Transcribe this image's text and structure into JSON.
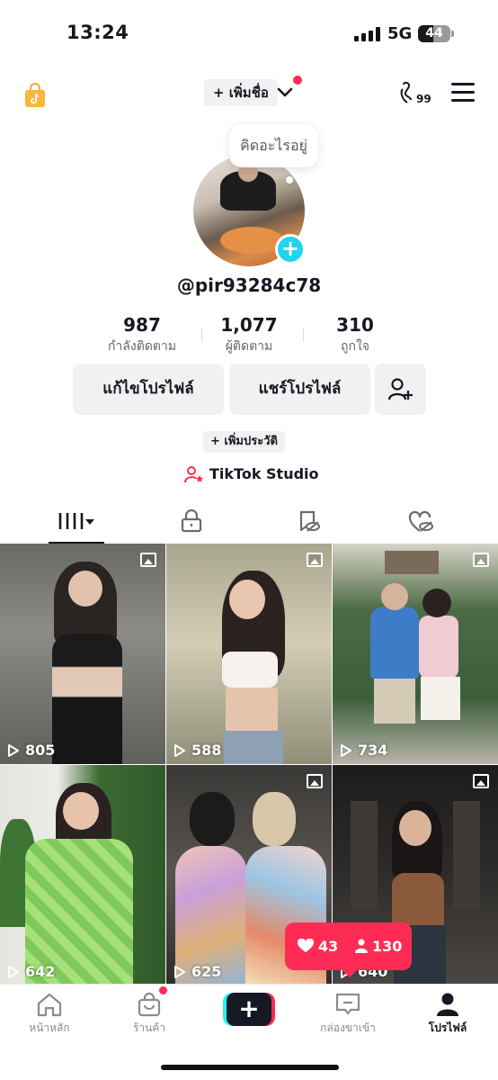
{
  "status_bar": {
    "time": "13:24",
    "network": "5G",
    "battery": "44"
  },
  "top_bar": {
    "add_name_label": "+ เพิ่มชื่อ",
    "badge_count": "99"
  },
  "profile": {
    "note_placeholder": "คิดอะไรอยู่",
    "username": "@pir93284c78",
    "stats": [
      {
        "value": "987",
        "label": "กำลังติดตาม"
      },
      {
        "value": "1,077",
        "label": "ผู้ติดตาม"
      },
      {
        "value": "310",
        "label": "ถูกใจ"
      }
    ],
    "edit_button": "แก้ไขโปรไฟล์",
    "share_button": "แชร์โปรไฟล์",
    "add_bio": "+ เพิ่มประวัติ",
    "studio_label": "TikTok Studio"
  },
  "tabs": [
    "videos-grid",
    "private",
    "reposts",
    "liked"
  ],
  "videos": [
    {
      "views": "805",
      "is_photo": true,
      "colors": [
        "#5b5a57",
        "#b4b2ad",
        "#2a2624"
      ]
    },
    {
      "views": "588",
      "is_photo": true,
      "colors": [
        "#9c9a86",
        "#e6dccb",
        "#d8c1a5"
      ]
    },
    {
      "views": "734",
      "is_photo": true,
      "colors": [
        "#3b5a3a",
        "#dad3c4",
        "#3a6fb5"
      ]
    },
    {
      "views": "642",
      "is_photo": false,
      "colors": [
        "#4e7a3f",
        "#e7e9e2",
        "#8fd36f"
      ]
    },
    {
      "views": "625",
      "is_photo": true,
      "colors": [
        "#3c3a3a",
        "#a7998c",
        "#e9b9a3"
      ]
    },
    {
      "views": "640",
      "is_photo": true,
      "colors": [
        "#1f1e1d",
        "#5b5753",
        "#8d5a38"
      ]
    }
  ],
  "popover": {
    "likes": "43",
    "followers": "130"
  },
  "bottom_nav": [
    {
      "label": "หน้าหลัก",
      "icon": "home-icon"
    },
    {
      "label": "ร้านค้า",
      "icon": "shop-bag-icon"
    },
    {
      "label": "",
      "icon": "create-icon"
    },
    {
      "label": "กล่องขาเข้า",
      "icon": "inbox-icon"
    },
    {
      "label": "โปรไฟล์",
      "icon": "profile-icon"
    }
  ]
}
